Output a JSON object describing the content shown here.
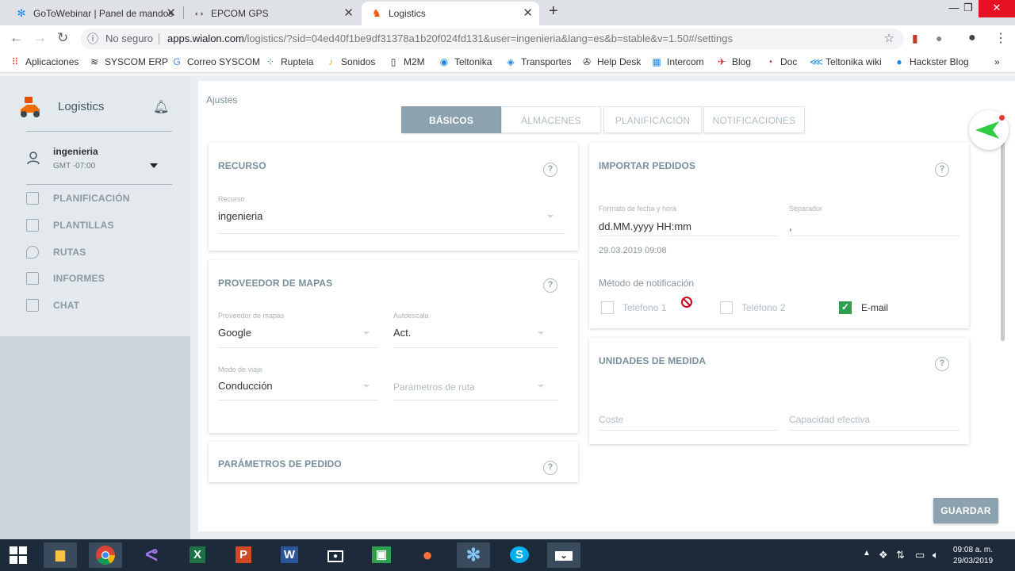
{
  "browser": {
    "tabs": [
      {
        "title": "GoToWebinar | Panel de mandos",
        "icon": "snowflake-icon"
      },
      {
        "title": "EPCOM GPS",
        "icon": "gps-icon"
      },
      {
        "title": "Logistics",
        "icon": "scooter-icon",
        "active": true
      }
    ],
    "new_tab": "+",
    "address": {
      "security": "No seguro",
      "domain": "apps.wialon.com",
      "path": "/logistics/?sid=04ed40f1be9df31378a1b20f024fd131&user=ingenieria&lang=es&b=stable&v=1.50#/settings"
    },
    "bookmarks": [
      "Aplicaciones",
      "SYSCOM ERP",
      "Correo SYSCOM",
      "Ruptela",
      "Sonidos",
      "M2M",
      "Teltonika",
      "Transportes",
      "Help Desk",
      "Intercom",
      "Blog",
      "Doc",
      "Teltonika wiki",
      "Hackster Blog"
    ],
    "bookmarks_more": "»"
  },
  "app": {
    "title": "Logistics",
    "user": {
      "name": "ingenieria",
      "timezone": "GMT -07:00"
    },
    "nav": [
      "PLANIFICACIÓN",
      "PLANTILLAS",
      "RUTAS",
      "INFORMES",
      "CHAT"
    ],
    "page_title": "Ajustes",
    "tabs": [
      "BÁSICOS",
      "ALMACENES",
      "PLANIFICACIÓN",
      "NOTIFICACIONES"
    ],
    "recurso": {
      "title": "RECURSO",
      "label": "Recurso",
      "value": "ingenieria"
    },
    "mapas": {
      "title": "PROVEEDOR DE MAPAS",
      "provider_label": "Proveedor de mapas",
      "provider_value": "Google",
      "autoscale_label": "Autoescala",
      "autoscale_value": "Act.",
      "travel_label": "Modo de viaje",
      "travel_value": "Conducción",
      "route_params_placeholder": "Parámetros de ruta"
    },
    "pedido": {
      "title": "PARÁMETROS DE PEDIDO"
    },
    "importar": {
      "title": "IMPORTAR PEDIDOS",
      "date_format_label": "Formato de fecha y hora",
      "date_format_value": "dd.MM.yyyy HH:mm",
      "date_example": "29.03.2019 09:08",
      "separator_label": "Separador",
      "separator_value": ",",
      "notify_label": "Método de notificación",
      "notify_options": [
        {
          "label": "Teléfono 1",
          "checked": false
        },
        {
          "label": "Teléfono 2",
          "checked": false
        },
        {
          "label": "E-mail",
          "checked": true
        }
      ]
    },
    "unidades": {
      "title": "UNIDADES DE MEDIDA",
      "cost_placeholder": "Coste",
      "capacity_placeholder": "Capacidad efectiva"
    },
    "save_label": "GUARDAR",
    "help_glyph": "?"
  },
  "taskbar": {
    "time": "09:08 a. m.",
    "date": "29/03/2019",
    "apps": [
      "start",
      "explorer",
      "chrome",
      "visual-studio",
      "excel",
      "powerpoint",
      "word",
      "screen-recorder",
      "store",
      "firefox",
      "gotowebinar",
      "skype",
      "download"
    ]
  },
  "colors": {
    "accent": "#8ca3af",
    "sidebar": "#ccd6dc",
    "checkbox_on": "#2e9e4f",
    "close_button": "#e81123"
  }
}
